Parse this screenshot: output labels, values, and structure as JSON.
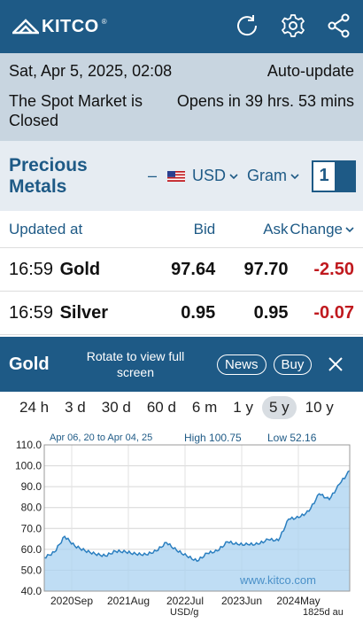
{
  "header": {
    "logo_text": "KITCO",
    "logo_mark": "®",
    "icons": [
      "refresh-icon",
      "gear-icon",
      "share-icon"
    ],
    "bg_color": "#1e5a86"
  },
  "status": {
    "datetime": "Sat, Apr 5, 2025, 02:08",
    "auto_update": "Auto-update",
    "market_state": "The Spot Market is Closed",
    "opens_in": "Opens in 39 hrs. 53 mins"
  },
  "metals": {
    "title": "Precious Metals",
    "dash": "–",
    "currency": "USD",
    "unit": "Gram",
    "toggle_value": "1"
  },
  "table": {
    "headers": {
      "updated": "Updated at",
      "bid": "Bid",
      "ask": "Ask",
      "change": "Change"
    },
    "rows": [
      {
        "time": "16:59",
        "name": "Gold",
        "bid": "97.64",
        "ask": "97.70",
        "change": "-2.50"
      },
      {
        "time": "16:59",
        "name": "Silver",
        "bid": "0.95",
        "ask": "0.95",
        "change": "-0.07"
      }
    ],
    "negative_color": "#c0191e"
  },
  "panel": {
    "title": "Gold",
    "rotate_hint": "Rotate to view full screen",
    "news_label": "News",
    "buy_label": "Buy"
  },
  "ranges": {
    "items": [
      "24 h",
      "3 d",
      "30 d",
      "60 d",
      "6 m",
      "1 y",
      "5 y",
      "10 y"
    ],
    "selected": "5 y"
  },
  "chart_data": {
    "type": "area",
    "date_range": "Apr 06, 20 to Apr 04, 25",
    "high_label": "High 100.75",
    "low_label": "Low 52.16",
    "watermark": "www.kitco.com",
    "unit_label": "USD/g",
    "span_label": "1825d au",
    "ylim": [
      40.0,
      110.0
    ],
    "yticks": [
      "110.0",
      "100.0",
      "90.0",
      "80.0",
      "70.0",
      "60.0",
      "50.0",
      "40.0"
    ],
    "xticks": [
      "2020Sep",
      "2021Aug",
      "2022Jul",
      "2023Jun",
      "2024May"
    ],
    "grid": true,
    "line_color": "#2b7fc0",
    "fill_color": "#a9d2f0",
    "x": [
      "2020-04",
      "2020-06",
      "2020-08",
      "2020-10",
      "2020-12",
      "2021-02",
      "2021-04",
      "2021-06",
      "2021-08",
      "2021-10",
      "2021-12",
      "2022-02",
      "2022-04",
      "2022-06",
      "2022-08",
      "2022-10",
      "2022-12",
      "2023-02",
      "2023-04",
      "2023-06",
      "2023-08",
      "2023-10",
      "2023-12",
      "2024-02",
      "2024-04",
      "2024-06",
      "2024-08",
      "2024-10",
      "2024-12",
      "2025-02",
      "2025-04"
    ],
    "values": [
      56.0,
      58.0,
      65.5,
      61.5,
      60.0,
      58.5,
      57.0,
      58.5,
      58.0,
      57.5,
      58.0,
      60.0,
      63.5,
      59.0,
      56.0,
      54.0,
      58.5,
      60.0,
      64.0,
      62.0,
      61.5,
      62.0,
      65.0,
      65.0,
      75.0,
      75.0,
      77.5,
      86.0,
      84.0,
      92.0,
      97.64
    ]
  }
}
